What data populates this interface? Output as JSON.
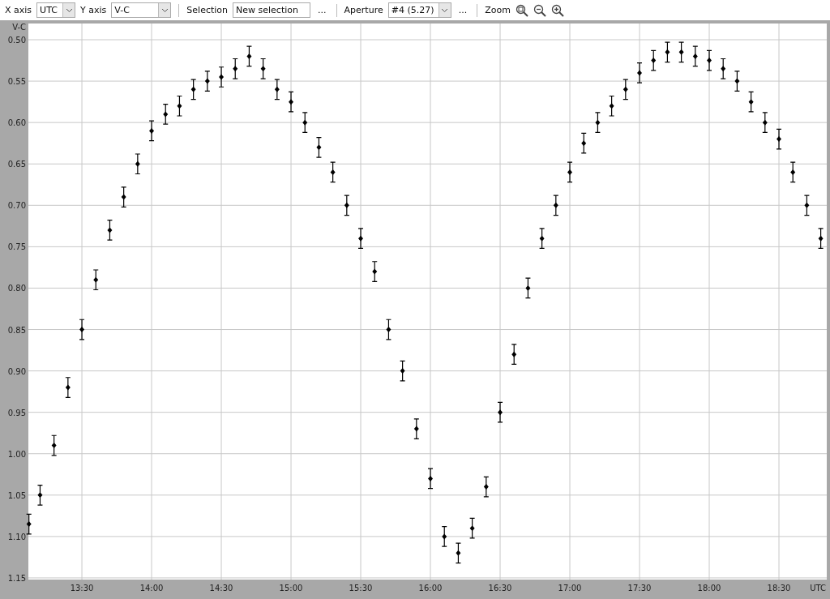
{
  "toolbar": {
    "x_axis": {
      "label": "X axis",
      "value": "UTC"
    },
    "y_axis": {
      "label": "Y axis",
      "value": "V-C"
    },
    "selection": {
      "label": "Selection",
      "value": "New selection",
      "more": "..."
    },
    "aperture": {
      "label": "Aperture",
      "value": "#4 (5.27)",
      "more": "..."
    },
    "zoom": {
      "label": "Zoom"
    }
  },
  "chart": {
    "chart_data": {
      "type": "scatter",
      "xlabel": "UTC",
      "ylabel": "V-C",
      "xlim": [
        13.116,
        18.843
      ],
      "ylim": [
        1.152,
        0.4804
      ],
      "grid": true,
      "xticks": [
        {
          "value": 13.5,
          "label": "13:30"
        },
        {
          "value": 14,
          "label": "14:00"
        },
        {
          "value": 14.5,
          "label": "14:30"
        },
        {
          "value": 15,
          "label": "15:00"
        },
        {
          "value": 15.5,
          "label": "15:30"
        },
        {
          "value": 16,
          "label": "16:00"
        },
        {
          "value": 16.5,
          "label": "16:30"
        },
        {
          "value": 17,
          "label": "17:00"
        },
        {
          "value": 17.5,
          "label": "17:30"
        },
        {
          "value": 18,
          "label": "18:00"
        },
        {
          "value": 18.5,
          "label": "18:30"
        }
      ],
      "yticks": [
        {
          "value": 0.5,
          "label": "0.50"
        },
        {
          "value": 0.55,
          "label": "0.55"
        },
        {
          "value": 0.6,
          "label": "0.60"
        },
        {
          "value": 0.65,
          "label": "0.65"
        },
        {
          "value": 0.7,
          "label": "0.70"
        },
        {
          "value": 0.75,
          "label": "0.75"
        },
        {
          "value": 0.8,
          "label": "0.80"
        },
        {
          "value": 0.85,
          "label": "0.85"
        },
        {
          "value": 0.9,
          "label": "0.90"
        },
        {
          "value": 0.95,
          "label": "0.95"
        },
        {
          "value": 1.0,
          "label": "1.00"
        },
        {
          "value": 1.05,
          "label": "1.05"
        },
        {
          "value": 1.1,
          "label": "1.10"
        },
        {
          "value": 1.15,
          "label": "1.15"
        }
      ],
      "x": [
        13.12,
        13.2,
        13.3,
        13.4,
        13.5,
        13.6,
        13.7,
        13.8,
        13.9,
        14.0,
        14.1,
        14.2,
        14.3,
        14.4,
        14.5,
        14.6,
        14.7,
        14.8,
        14.9,
        15.0,
        15.1,
        15.2,
        15.3,
        15.4,
        15.5,
        15.6,
        15.7,
        15.8,
        15.9,
        16.0,
        16.1,
        16.2,
        16.3,
        16.4,
        16.5,
        16.6,
        16.7,
        16.8,
        16.9,
        17.0,
        17.1,
        17.2,
        17.3,
        17.4,
        17.5,
        17.6,
        17.7,
        17.8,
        17.9,
        18.0,
        18.1,
        18.2,
        18.3,
        18.4,
        18.5,
        18.6,
        18.7,
        18.8
      ],
      "series": [
        {
          "color": "#000000",
          "errors": [
            0.012,
            0.012,
            0.012,
            0.012,
            0.012,
            0.012,
            0.012,
            0.012,
            0.012,
            0.012,
            0.012,
            0.012,
            0.012,
            0.012,
            0.012,
            0.012,
            0.012,
            0.012,
            0.012,
            0.012,
            0.012,
            0.012,
            0.012,
            0.012,
            0.012,
            0.012,
            0.012,
            0.012,
            0.012,
            0.012,
            0.012,
            0.012,
            0.012,
            0.012,
            0.012,
            0.012,
            0.012,
            0.012,
            0.012,
            0.012,
            0.012,
            0.012,
            0.012,
            0.012,
            0.012,
            0.012,
            0.012,
            0.012,
            0.012,
            0.012,
            0.012,
            0.012,
            0.012,
            0.012,
            0.012,
            0.012,
            0.012,
            0.012
          ],
          "values": [
            1.085,
            1.05,
            0.99,
            0.92,
            0.85,
            0.79,
            0.73,
            0.69,
            0.65,
            0.61,
            0.59,
            0.58,
            0.56,
            0.55,
            0.545,
            0.535,
            0.52,
            0.535,
            0.56,
            0.575,
            0.6,
            0.63,
            0.66,
            0.7,
            0.74,
            0.78,
            0.85,
            0.9,
            0.97,
            1.03,
            1.1,
            1.12,
            1.09,
            1.04,
            0.95,
            0.88,
            0.8,
            0.74,
            0.7,
            0.66,
            0.625,
            0.6,
            0.58,
            0.56,
            0.54,
            0.525,
            0.515,
            0.515,
            0.52,
            0.525,
            0.535,
            0.55,
            0.575,
            0.6,
            0.62,
            0.66,
            0.7,
            0.74
          ]
        }
      ]
    }
  }
}
